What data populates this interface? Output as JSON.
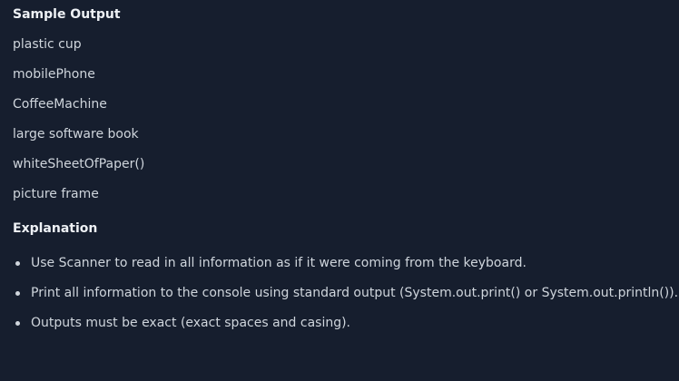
{
  "sample": {
    "heading": "Sample Output",
    "lines": [
      "plastic cup",
      "mobilePhone",
      "CoffeeMachine",
      "large software book",
      "whiteSheetOfPaper()",
      "picture frame"
    ]
  },
  "explanation": {
    "heading": "Explanation",
    "bullets": [
      "Use Scanner to read in all information as if it were coming from the keyboard.",
      "Print all information to the console using standard output (System.out.print() or System.out.println()).",
      "Outputs must be exact (exact spaces and casing)."
    ]
  }
}
